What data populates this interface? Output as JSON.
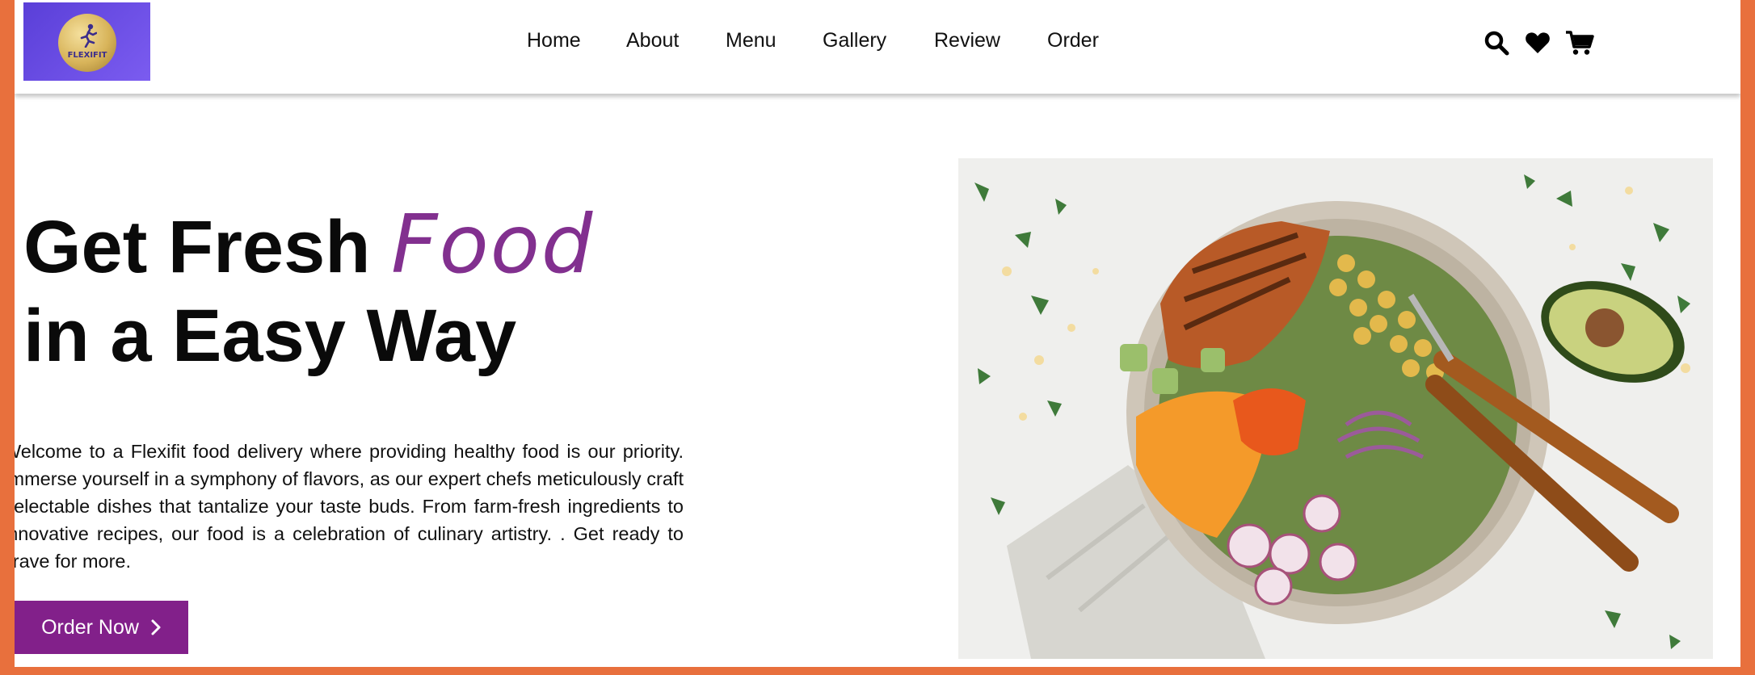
{
  "brand": {
    "logo_text": "FLEXIFIT"
  },
  "nav": {
    "links": [
      {
        "label": "Home"
      },
      {
        "label": "About"
      },
      {
        "label": "Menu"
      },
      {
        "label": "Gallery"
      },
      {
        "label": "Review"
      },
      {
        "label": "Order"
      }
    ],
    "icons": [
      "search-icon",
      "heart-icon",
      "cart-icon"
    ]
  },
  "hero": {
    "title_part1": "Get Fresh",
    "title_accent": "Food",
    "title_line2": "in a Easy Way",
    "description": "Welcome to a Flexifit food delivery where providing healthy food is our priority. Immerse yourself in a symphony of flavors, as our expert chefs meticulously craft delectable dishes that tantalize your taste buds. From farm-fresh ingredients to innovative recipes, our food is a celebration of culinary artistry. . Get ready to crave for more.",
    "cta_label": "Order Now",
    "cta_icon": "chevron-right-icon",
    "image_subject": "salad-bowl"
  },
  "colors": {
    "frame": "#e8703d",
    "accent": "#82308f",
    "button": "#82208a",
    "logo_bg": "#5a3fd8"
  }
}
